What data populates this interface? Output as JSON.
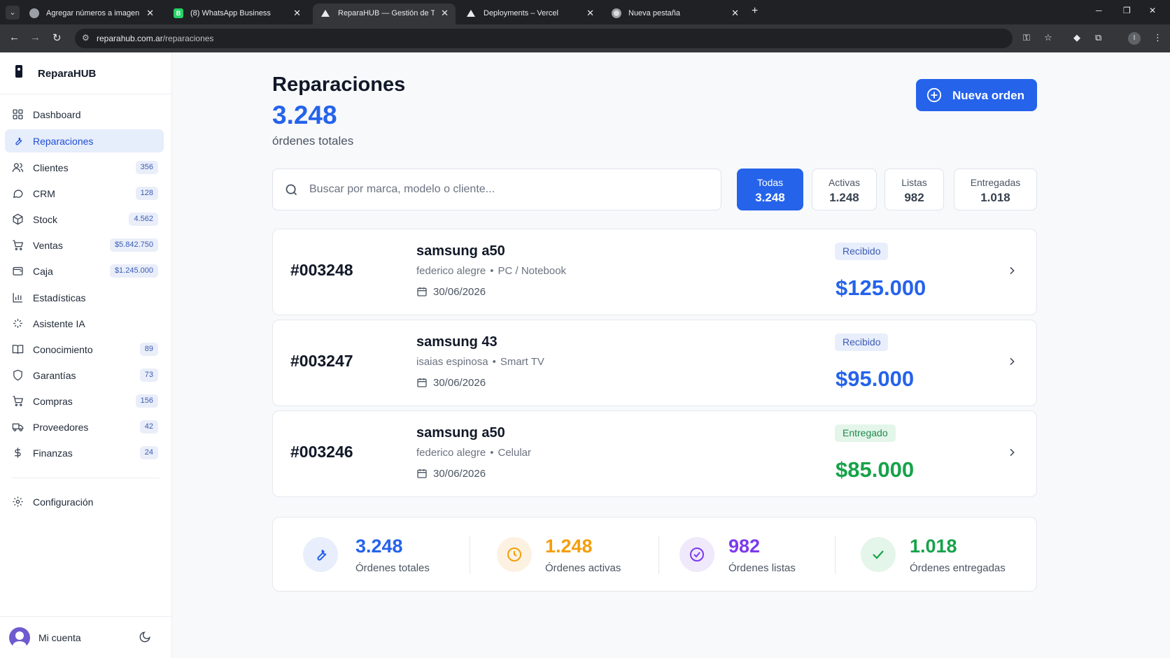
{
  "browser": {
    "tabs": [
      {
        "title": "Agregar números a imagen",
        "active": false
      },
      {
        "title": "(8) WhatsApp Business",
        "active": false
      },
      {
        "title": "ReparaHUB — Gestión de Taller",
        "active": true
      },
      {
        "title": "Deployments – Vercel",
        "active": false
      },
      {
        "title": "Nueva pestaña",
        "active": false
      }
    ],
    "url_host": "reparahub.com.ar",
    "url_path": "/reparaciones",
    "profile_initial": "I"
  },
  "sidebar": {
    "brand": "ReparaHUB",
    "items": [
      {
        "label": "Dashboard",
        "icon": "grid-icon",
        "badge": ""
      },
      {
        "label": "Reparaciones",
        "icon": "wrench-icon",
        "badge": "",
        "active": true
      },
      {
        "label": "Clientes",
        "icon": "users-icon",
        "badge": "356"
      },
      {
        "label": "CRM",
        "icon": "chat-icon",
        "badge": "128"
      },
      {
        "label": "Stock",
        "icon": "box-icon",
        "badge": "4.562"
      },
      {
        "label": "Ventas",
        "icon": "cart-icon",
        "badge": "$5.842.750"
      },
      {
        "label": "Caja",
        "icon": "wallet-icon",
        "badge": "$1.245.000"
      },
      {
        "label": "Estadísticas",
        "icon": "bar-chart-icon",
        "badge": ""
      },
      {
        "label": "Asistente IA",
        "icon": "sparkle-icon",
        "badge": ""
      },
      {
        "label": "Conocimiento",
        "icon": "book-icon",
        "badge": "89"
      },
      {
        "label": "Garantías",
        "icon": "shield-icon",
        "badge": "73"
      },
      {
        "label": "Compras",
        "icon": "cart-icon",
        "badge": "156"
      },
      {
        "label": "Proveedores",
        "icon": "truck-icon",
        "badge": "42"
      },
      {
        "label": "Finanzas",
        "icon": "dollar-icon",
        "badge": "24"
      }
    ],
    "settings_label": "Configuración",
    "account_label": "Mi cuenta"
  },
  "header": {
    "title": "Reparaciones",
    "total": "3.248",
    "total_label": "órdenes totales",
    "new_order_label": "Nueva orden"
  },
  "search": {
    "placeholder": "Buscar por marca, modelo o cliente...",
    "value": ""
  },
  "filters": [
    {
      "label": "Todas",
      "count": "3.248",
      "active": true
    },
    {
      "label": "Activas",
      "count": "1.248",
      "active": false
    },
    {
      "label": "Listas",
      "count": "982",
      "active": false
    },
    {
      "label": "Entregadas",
      "count": "1.018",
      "active": false
    }
  ],
  "orders": [
    {
      "number": "#003248",
      "device": "samsung a50",
      "client": "federico alegre",
      "category": "PC / Notebook",
      "date": "30/06/2026",
      "status": "Recibido",
      "status_color": "#3b5bb5",
      "price": "$125.000",
      "price_color": "#2563eb"
    },
    {
      "number": "#003247",
      "device": "samsung 43",
      "client": "isaias espinosa",
      "category": "Smart TV",
      "date": "30/06/2026",
      "status": "Recibido",
      "status_color": "#3b5bb5",
      "price": "$95.000",
      "price_color": "#2563eb"
    },
    {
      "number": "#003246",
      "device": "samsung a50",
      "client": "federico alegre",
      "category": "Celular",
      "date": "30/06/2026",
      "status": "Entregado",
      "status_color": "#1f8a4c",
      "price": "$85.000",
      "price_color": "#16a34a"
    }
  ],
  "stats": [
    {
      "value": "3.248",
      "label": "Órdenes totales",
      "color": "#2563eb",
      "icon": "wrench-icon"
    },
    {
      "value": "1.248",
      "label": "Órdenes activas",
      "color": "#f59e0b",
      "icon": "clock-icon"
    },
    {
      "value": "982",
      "label": "Órdenes listas",
      "color": "#7c3aed",
      "icon": "check-circle-icon"
    },
    {
      "value": "1.018",
      "label": "Órdenes entregadas",
      "color": "#16a34a",
      "icon": "check-icon"
    }
  ],
  "colors": {
    "accent": "#2563eb",
    "active_bg": "#e6edfb",
    "success": "#16a34a",
    "warning": "#f59e0b",
    "purple": "#7c3aed"
  }
}
